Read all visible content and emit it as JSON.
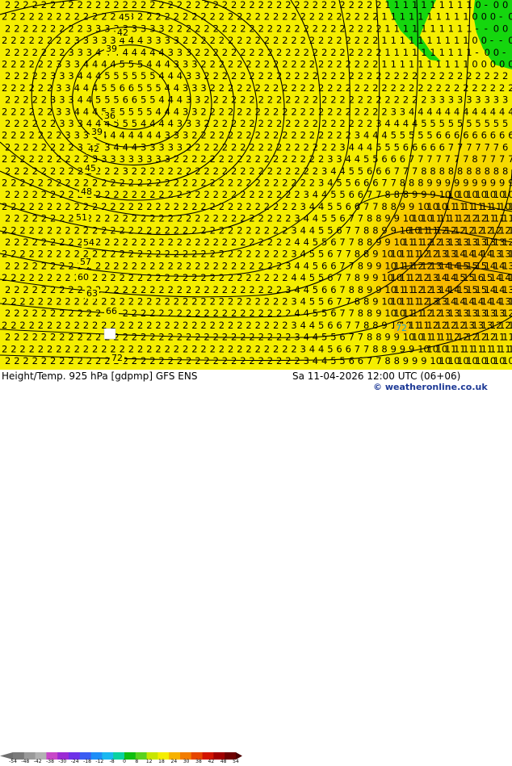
{
  "map": {
    "title": "Height/Temp. 925 hPa [gdpmp] GFS ENS",
    "valid_time": "Sa 11-04-2026 12:00 UTC (06+06)",
    "credit": "© weatheronline.co.uk",
    "colors": {
      "background_yellow": "#f5ee00",
      "warm_orange": "#f7b200",
      "green": "#15d60e",
      "contour": "#000000"
    },
    "contour_labels": [
      "45",
      "42",
      "39",
      "36",
      "39",
      "42",
      "45",
      "48",
      "51",
      "54",
      "57",
      "60",
      "63",
      "66",
      "72",
      "72"
    ],
    "colorbar": {
      "ticks": [
        "-54",
        "-48",
        "-42",
        "-38",
        "-30",
        "-24",
        "-18",
        "-12",
        "-8",
        "0",
        "8",
        "12",
        "18",
        "24",
        "30",
        "38",
        "42",
        "48",
        "54"
      ],
      "colors": [
        "#7a7a7a",
        "#9a9a9a",
        "#b2b2b2",
        "#c848c8",
        "#9b2bd4",
        "#6e32e8",
        "#3a5cf2",
        "#1e8ef7",
        "#19b8f0",
        "#0ad2a0",
        "#10be10",
        "#5ad21e",
        "#c8e600",
        "#f5ee00",
        "#f7b200",
        "#f27d00",
        "#e64600",
        "#d21400",
        "#a00000",
        "#6e0000"
      ]
    }
  }
}
